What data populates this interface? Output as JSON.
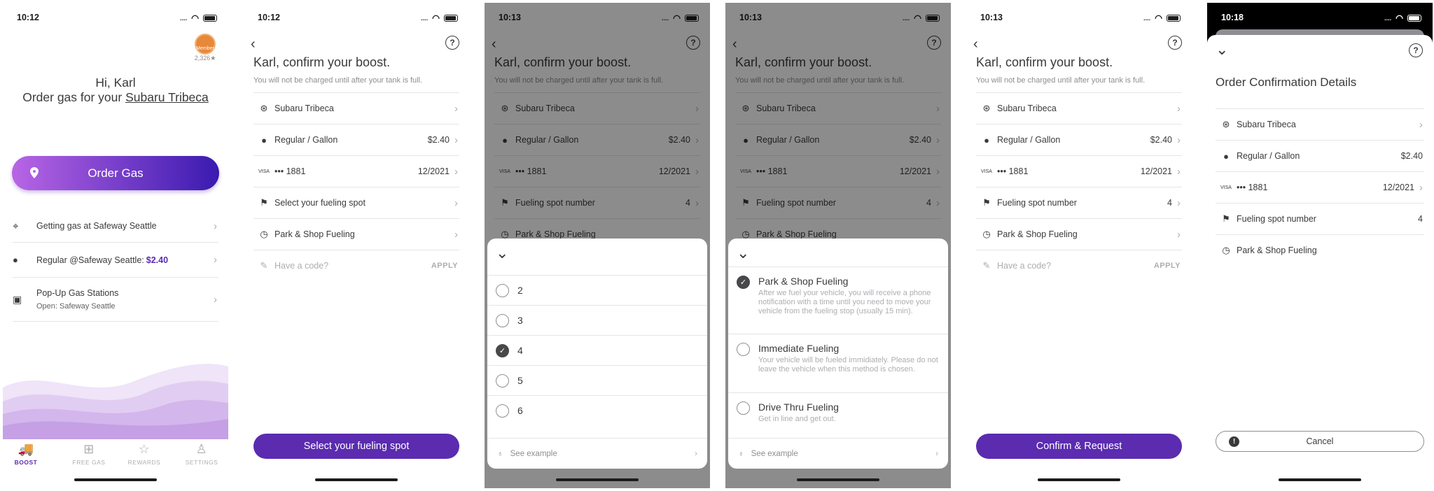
{
  "status_times": [
    "10:12",
    "10:12",
    "10:13",
    "10:13",
    "10:13",
    "10:18"
  ],
  "home": {
    "badge_label": "Member",
    "badge_points": "2,326★",
    "greeting": "Hi, Karl",
    "order_prefix": "Order gas for your",
    "car": "Subaru Tribeca",
    "order_button": "Order Gas",
    "items": [
      {
        "label": "Getting gas at Safeway Seattle",
        "icon": "location-icon"
      },
      {
        "label": "Regular @Safeway Seattle: ",
        "price": "$2.40",
        "icon": "drop-icon"
      },
      {
        "label": "Pop-Up Gas Stations",
        "sub": "Open: Safeway Seattle",
        "icon": "calendar-icon"
      }
    ],
    "tabs": [
      "BOOST",
      "FREE GAS",
      "REWARDS",
      "SETTINGS"
    ]
  },
  "confirm": {
    "title": "Karl, confirm your boost.",
    "subtitle": "You will not be charged until after your tank is full.",
    "car": "Subaru Tribeca",
    "fuel": "Regular / Gallon",
    "price": "$2.40",
    "card_brand": "VISA",
    "card": "••• 1881",
    "expiry": "12/2021",
    "spot_select": "Select your fueling spot",
    "spot_label": "Fueling spot number",
    "spot_value": "4",
    "method": "Park & Shop Fueling",
    "code_placeholder": "Have a code?",
    "apply": "APPLY",
    "select_button": "Select your fueling spot",
    "confirm_button": "Confirm & Request"
  },
  "spot_sheet": {
    "options": [
      "2",
      "3",
      "4",
      "5",
      "6"
    ],
    "selected": "4",
    "see_example": "See example"
  },
  "method_sheet": {
    "options": [
      {
        "title": "Park & Shop Fueling",
        "desc": "After we fuel your vehicle, you will receive a phone notification with a time until you need to move your vehicle from the fueling stop (usually 15 min).",
        "selected": true
      },
      {
        "title": "Immediate Fueling",
        "desc": "Your vehicle will be fueled immidiately. Please do not leave the vehicle when this method is chosen.",
        "selected": false
      },
      {
        "title": "Drive Thru Fueling",
        "desc": "Get in line and get out.",
        "selected": false
      }
    ],
    "see_example": "See example"
  },
  "details": {
    "title": "Order Confirmation Details",
    "cancel": "Cancel"
  },
  "colors": {
    "accent": "#5b2bb0",
    "gradient_start": "#b865e5",
    "gradient_end": "#3a1ab0"
  }
}
